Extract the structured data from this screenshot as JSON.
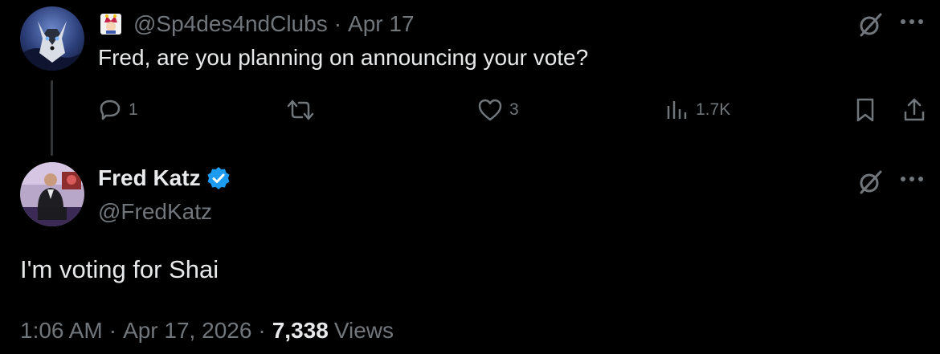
{
  "reply": {
    "handle": "@Sp4des4ndClubs",
    "separator": "·",
    "date": "Apr 17",
    "text": "Fred, are you planning on announcing your vote?",
    "stats": {
      "replies": "1",
      "likes": "3",
      "views": "1.7K"
    }
  },
  "main": {
    "name": "Fred Katz",
    "handle": "@FredKatz",
    "text": "I'm voting for Shai",
    "time": "1:06 AM",
    "sep1": "·",
    "date": "Apr 17, 2026",
    "sep2": "·",
    "views_count": "7,338",
    "views_label": "Views"
  },
  "colors": {
    "background": "#000000",
    "text": "#e7e9ea",
    "muted": "#71767b",
    "verified": "#1d9bf0"
  },
  "icons": [
    "grok-icon",
    "more-icon",
    "reply-icon",
    "retweet-icon",
    "like-icon",
    "views-icon",
    "bookmark-icon",
    "share-icon",
    "verified-badge-icon",
    "jester-emoji-icon"
  ]
}
